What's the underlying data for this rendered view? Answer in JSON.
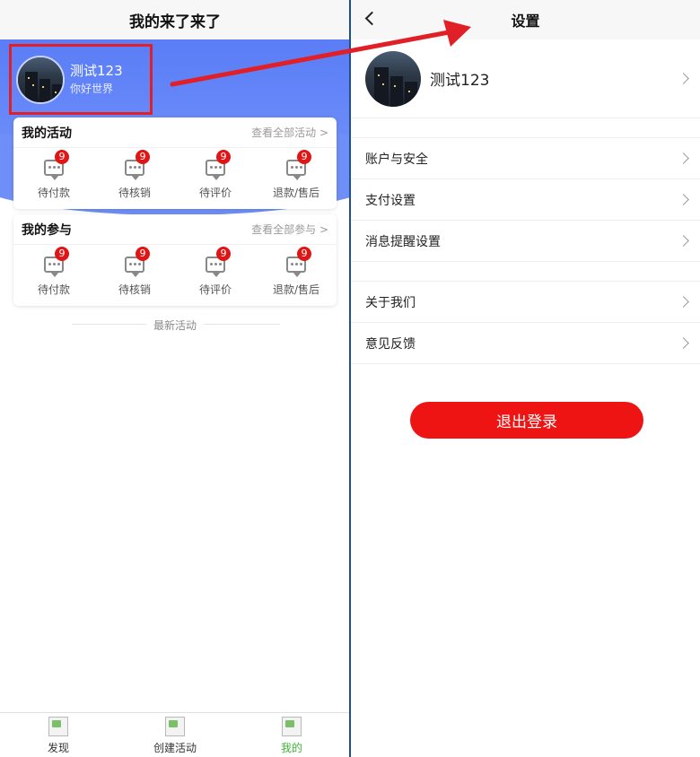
{
  "left": {
    "header": {
      "title": "我的来了来了"
    },
    "profile": {
      "name": "测试123",
      "subtitle": "你好世界"
    },
    "activities": {
      "title": "我的活动",
      "view_all": "查看全部活动 >",
      "items": [
        {
          "label": "待付款",
          "badge": "9"
        },
        {
          "label": "待核销",
          "badge": "9"
        },
        {
          "label": "待评价",
          "badge": "9"
        },
        {
          "label": "退款/售后",
          "badge": "9"
        }
      ]
    },
    "participation": {
      "title": "我的参与",
      "view_all": "查看全部参与 >",
      "items": [
        {
          "label": "待付款",
          "badge": "9"
        },
        {
          "label": "待核销",
          "badge": "9"
        },
        {
          "label": "待评价",
          "badge": "9"
        },
        {
          "label": "退款/售后",
          "badge": "9"
        }
      ]
    },
    "latest_divider": "最新活动",
    "tabbar": [
      {
        "label": "发现",
        "active": false
      },
      {
        "label": "创建活动",
        "active": false
      },
      {
        "label": "我的",
        "active": true
      }
    ]
  },
  "right": {
    "header": {
      "title": "设置"
    },
    "profile": {
      "name": "测试123"
    },
    "group1": [
      "账户与安全",
      "支付设置",
      "消息提醒设置"
    ],
    "group2": [
      "关于我们",
      "意见反馈"
    ],
    "logout_label": "退出登录"
  },
  "colors": {
    "hero_blue": "#5a7df7",
    "annotation_red": "#e11f26",
    "logout_red": "#ee1414",
    "badge_red": "#e01515",
    "tab_active_green": "#3fb53a",
    "separator_blue": "#1d4f91"
  }
}
